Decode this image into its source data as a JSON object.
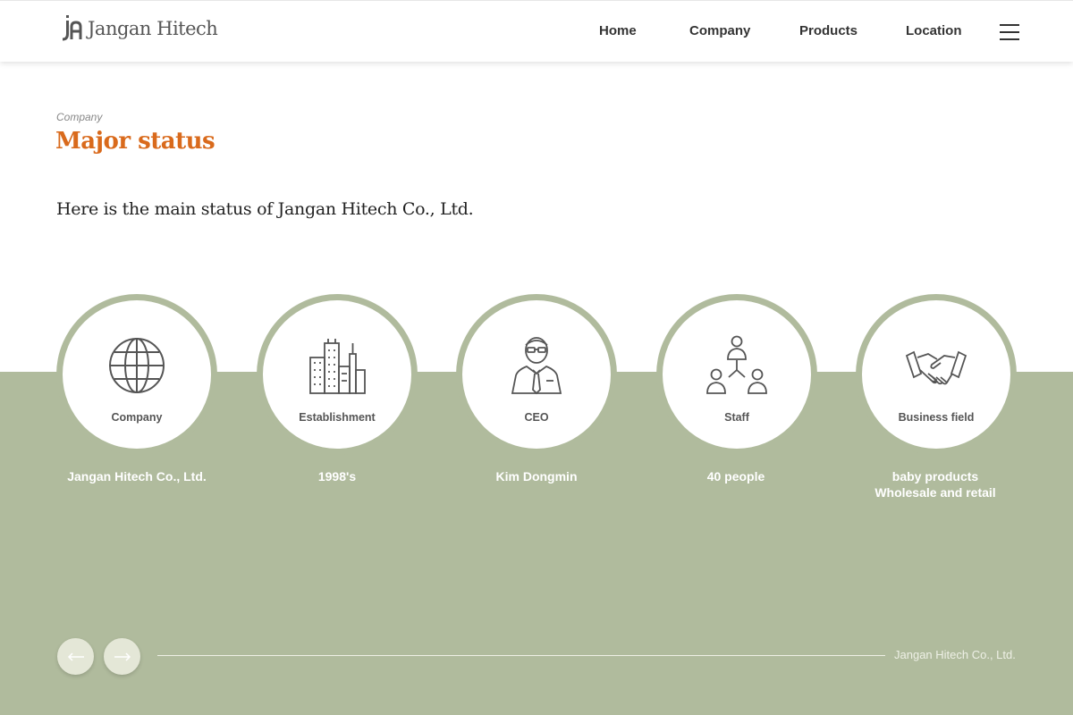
{
  "header": {
    "logo_text": "Jangan Hitech",
    "nav": [
      {
        "label": "Home"
      },
      {
        "label": "Company"
      },
      {
        "label": "Products"
      },
      {
        "label": "Location"
      }
    ]
  },
  "intro": {
    "breadcrumb": "Company",
    "title": "Major status",
    "lead": "Here is the main status of Jangan Hitech Co., Ltd."
  },
  "status_cards": [
    {
      "icon": "globe-icon",
      "label": "Company",
      "value_lines": [
        "Jangan Hitech Co., Ltd."
      ]
    },
    {
      "icon": "buildings-icon",
      "label": "Establishment",
      "value_lines": [
        "1998's"
      ]
    },
    {
      "icon": "ceo-person-icon",
      "label": "CEO",
      "value_lines": [
        "Kim Dongmin"
      ]
    },
    {
      "icon": "org-chart-icon",
      "label": "Staff",
      "value_lines": [
        "40 people"
      ]
    },
    {
      "icon": "handshake-icon",
      "label": "Business field",
      "value_lines": [
        "baby products",
        "Wholesale and retail"
      ]
    }
  ],
  "slider": {
    "caption": "Jangan Hitech Co., Ltd."
  },
  "colors": {
    "accent": "#d96a1c",
    "band": "#b0bb9d",
    "text_dark": "#222222"
  }
}
